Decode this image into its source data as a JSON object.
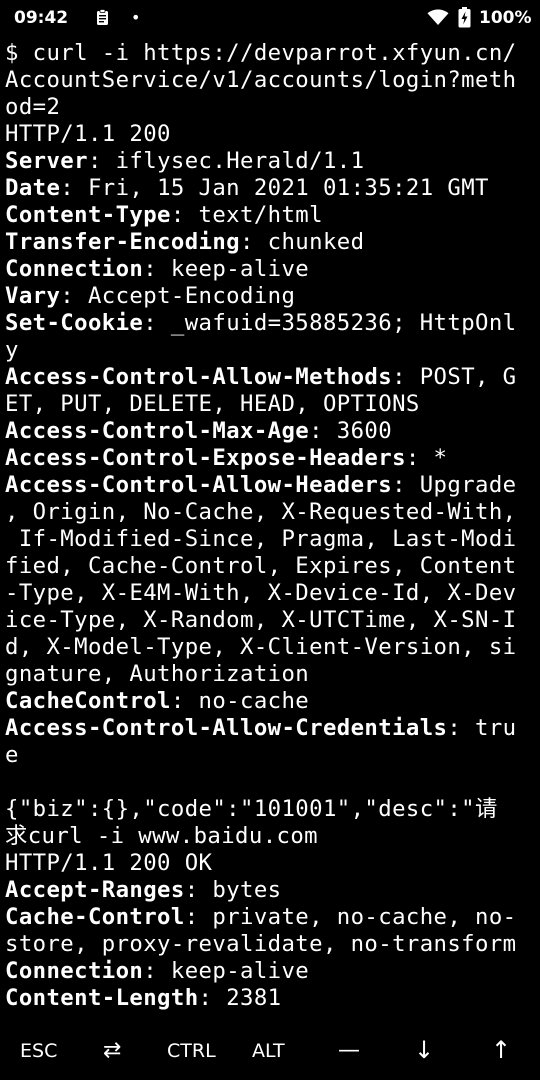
{
  "status_bar": {
    "time": "09:42",
    "dot": "•",
    "battery_percent": "100%",
    "icons": [
      "clipboard-icon",
      "wifi-icon",
      "battery-charging-icon"
    ]
  },
  "terminal": {
    "lines": [
      [
        {
          "t": "$ curl -i https://devparrot.xfyun.cn/"
        }
      ],
      [
        {
          "t": "AccountService/v1/accounts/login?meth"
        }
      ],
      [
        {
          "t": "od=2"
        }
      ],
      [
        {
          "t": "HTTP/1.1 200"
        }
      ],
      [
        {
          "t": "Server",
          "b": true
        },
        {
          "t": ": iflysec.Herald/1.1"
        }
      ],
      [
        {
          "t": "Date",
          "b": true
        },
        {
          "t": ": Fri, 15 Jan 2021 01:35:21 GMT"
        }
      ],
      [
        {
          "t": "Content-Type",
          "b": true
        },
        {
          "t": ": text/html"
        }
      ],
      [
        {
          "t": "Transfer-Encoding",
          "b": true
        },
        {
          "t": ": chunked"
        }
      ],
      [
        {
          "t": "Connection",
          "b": true
        },
        {
          "t": ": keep-alive"
        }
      ],
      [
        {
          "t": "Vary",
          "b": true
        },
        {
          "t": ": Accept-Encoding"
        }
      ],
      [
        {
          "t": "Set-Cookie",
          "b": true
        },
        {
          "t": ": _wafuid=35885236; HttpOnl"
        }
      ],
      [
        {
          "t": "y"
        }
      ],
      [
        {
          "t": "Access-Control-Allow-Methods",
          "b": true
        },
        {
          "t": ": POST, G"
        }
      ],
      [
        {
          "t": "ET, PUT, DELETE, HEAD, OPTIONS"
        }
      ],
      [
        {
          "t": "Access-Control-Max-Age",
          "b": true
        },
        {
          "t": ": 3600"
        }
      ],
      [
        {
          "t": "Access-Control-Expose-Headers",
          "b": true
        },
        {
          "t": ": *"
        }
      ],
      [
        {
          "t": "Access-Control-Allow-Headers",
          "b": true
        },
        {
          "t": ": Upgrade"
        }
      ],
      [
        {
          "t": ", Origin, No-Cache, X-Requested-With,"
        }
      ],
      [
        {
          "t": " If-Modified-Since, Pragma, Last-Modi"
        }
      ],
      [
        {
          "t": "fied, Cache-Control, Expires, Content"
        }
      ],
      [
        {
          "t": "-Type, X-E4M-With, X-Device-Id, X-Dev"
        }
      ],
      [
        {
          "t": "ice-Type, X-Random, X-UTCTime, X-SN-I"
        }
      ],
      [
        {
          "t": "d, X-Model-Type, X-Client-Version, si"
        }
      ],
      [
        {
          "t": "gnature, Authorization"
        }
      ],
      [
        {
          "t": "CacheControl",
          "b": true
        },
        {
          "t": ": no-cache"
        }
      ],
      [
        {
          "t": "Access-Control-Allow-Credentials",
          "b": true
        },
        {
          "t": ": tru"
        }
      ],
      [
        {
          "t": "e"
        }
      ],
      [
        {
          "t": ""
        }
      ],
      [
        {
          "t": "{\"biz\":{},\"code\":\"101001\",\"desc\":\"请"
        }
      ],
      [
        {
          "t": "求curl -i www.baidu.com"
        }
      ],
      [
        {
          "t": "HTTP/1.1 200 OK"
        }
      ],
      [
        {
          "t": "Accept-Ranges",
          "b": true
        },
        {
          "t": ": bytes"
        }
      ],
      [
        {
          "t": "Cache-Control",
          "b": true
        },
        {
          "t": ": private, no-cache, no-"
        }
      ],
      [
        {
          "t": "store, proxy-revalidate, no-transform"
        }
      ],
      [
        {
          "t": "Connection",
          "b": true
        },
        {
          "t": ": keep-alive"
        }
      ],
      [
        {
          "t": "Content-Length",
          "b": true
        },
        {
          "t": ": 2381"
        }
      ]
    ]
  },
  "extra_keys": {
    "esc": "ESC",
    "tab": "⇄",
    "ctrl": "CTRL",
    "alt": "ALT",
    "dash": "—",
    "down": "↓",
    "up": "↑"
  }
}
